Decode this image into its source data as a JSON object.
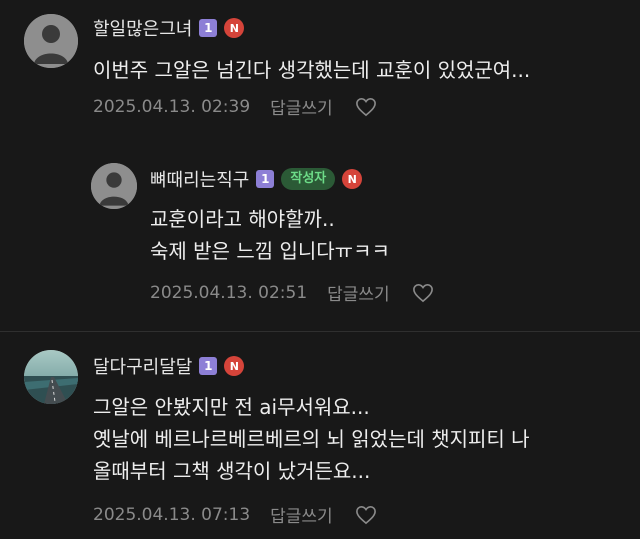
{
  "comments": [
    {
      "nickname": "할일많은그녀",
      "level": "1",
      "new_badge": "N",
      "lines": [
        "이번주 그알은 넘긴다 생각했는데 교훈이 있었군여..."
      ],
      "date": "2025.04.13. 02:39",
      "reply_label": "답글쓰기"
    },
    {
      "nickname": "뼈때리는직구",
      "level": "1",
      "author_badge": "작성자",
      "new_badge": "N",
      "lines": [
        "교훈이라고 해야할까..",
        "숙제 받은 느낌 입니다ㅠㅋㅋ"
      ],
      "date": "2025.04.13. 02:51",
      "reply_label": "답글쓰기"
    },
    {
      "nickname": "달다구리달달",
      "level": "1",
      "new_badge": "N",
      "lines": [
        "그알은 안봤지만 전 ai무서워요...",
        "옛날에 베르나르베르베르의 뇌 읽었는데 챗지피티 나",
        "올때부터 그책 생각이 났거든요..."
      ],
      "date": "2025.04.13. 07:13",
      "reply_label": "답글쓰기"
    }
  ],
  "colors": {
    "background": "#181818",
    "level_badge": "#8d7fd6",
    "new_badge": "#d5443a",
    "author_badge_bg": "#2b5a36",
    "author_badge_text": "#6ddc88"
  },
  "icons": {
    "avatar_default": "person-silhouette",
    "avatar_photo": "road-landscape",
    "like": "heart-outline"
  }
}
